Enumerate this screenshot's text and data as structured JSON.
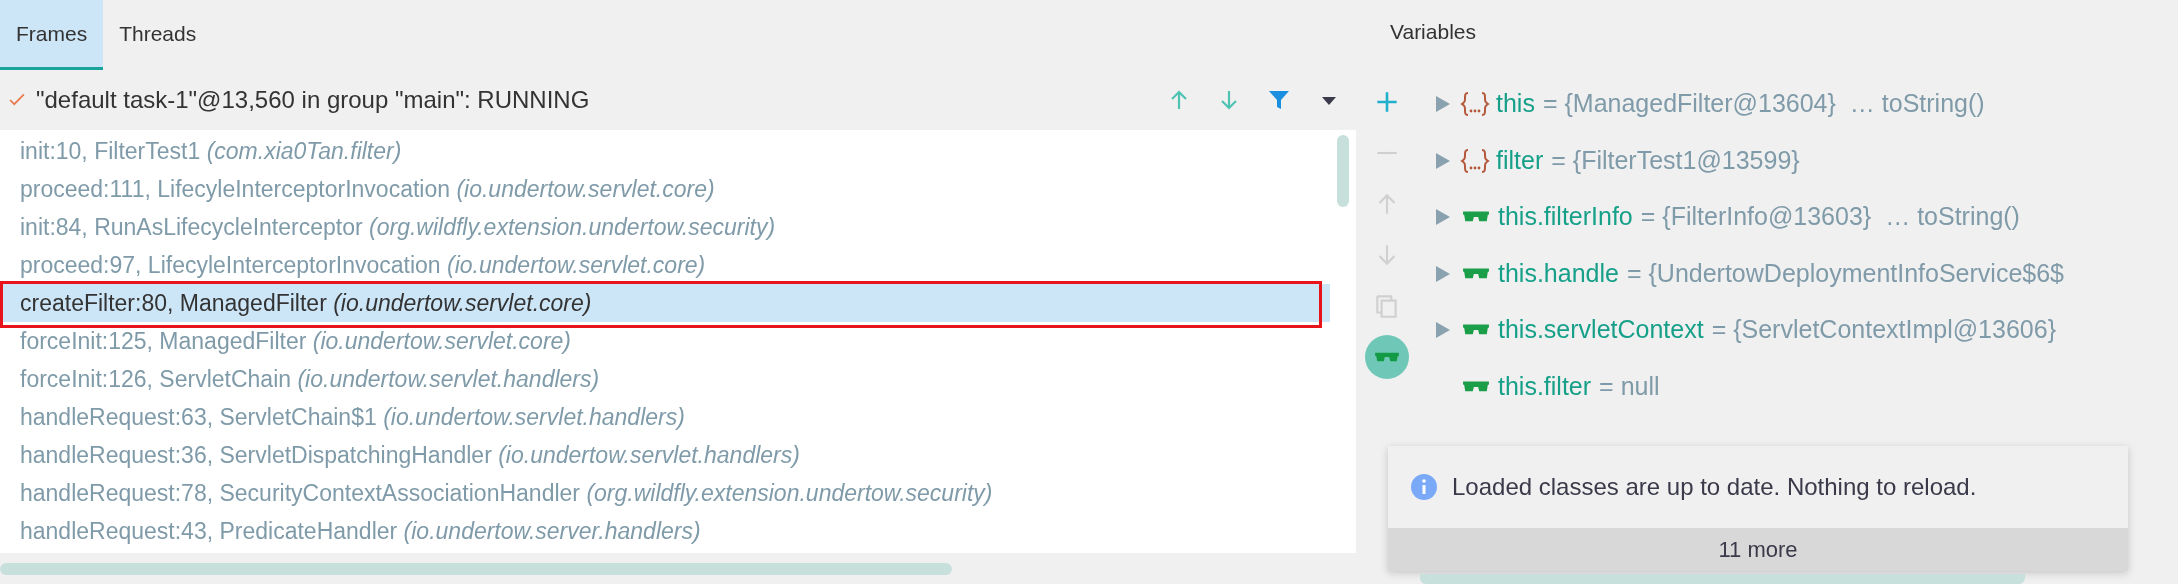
{
  "tabs": [
    {
      "label": "Frames",
      "selected": true
    },
    {
      "label": "Threads",
      "selected": false
    }
  ],
  "thread": {
    "text": "\"default task-1\"@13,560 in group \"main\": RUNNING"
  },
  "frames": [
    {
      "method": "init:10, FilterTest1",
      "package": "(com.xia0Tan.filter)",
      "selected": false,
      "boxed": false
    },
    {
      "method": "proceed:111, LifecyleInterceptorInvocation",
      "package": "(io.undertow.servlet.core)",
      "selected": false,
      "boxed": false
    },
    {
      "method": "init:84, RunAsLifecycleInterceptor",
      "package": "(org.wildfly.extension.undertow.security)",
      "selected": false,
      "boxed": false
    },
    {
      "method": "proceed:97, LifecyleInterceptorInvocation",
      "package": "(io.undertow.servlet.core)",
      "selected": false,
      "boxed": false
    },
    {
      "method": "createFilter:80, ManagedFilter",
      "package": "(io.undertow.servlet.core)",
      "selected": true,
      "boxed": true
    },
    {
      "method": "forceInit:125, ManagedFilter",
      "package": "(io.undertow.servlet.core)",
      "selected": false,
      "boxed": false
    },
    {
      "method": "forceInit:126, ServletChain",
      "package": "(io.undertow.servlet.handlers)",
      "selected": false,
      "boxed": false
    },
    {
      "method": "handleRequest:63, ServletChain$1",
      "package": "(io.undertow.servlet.handlers)",
      "selected": false,
      "boxed": false
    },
    {
      "method": "handleRequest:36, ServletDispatchingHandler",
      "package": "(io.undertow.servlet.handlers)",
      "selected": false,
      "boxed": false
    },
    {
      "method": "handleRequest:78, SecurityContextAssociationHandler",
      "package": "(org.wildfly.extension.undertow.security)",
      "selected": false,
      "boxed": false
    },
    {
      "method": "handleRequest:43, PredicateHandler",
      "package": "(io.undertow.server.handlers)",
      "selected": false,
      "boxed": false
    }
  ],
  "variables_title": "Variables",
  "variable_tools": [
    {
      "kind": "add",
      "disabled": false,
      "on": false
    },
    {
      "kind": "remove",
      "disabled": true,
      "on": false
    },
    {
      "kind": "up",
      "disabled": true,
      "on": false
    },
    {
      "kind": "down",
      "disabled": true,
      "on": false
    },
    {
      "kind": "copy",
      "disabled": true,
      "on": false
    },
    {
      "kind": "watches",
      "disabled": false,
      "on": true
    }
  ],
  "variables": [
    {
      "kind": "object",
      "name": "this",
      "value": "= {ManagedFilter@13604}",
      "extra": "… toString()",
      "expandable": true
    },
    {
      "kind": "object",
      "name": "filter",
      "value": "= {FilterTest1@13599}",
      "expandable": true
    },
    {
      "kind": "watch",
      "name": "this.filterInfo",
      "value": "= {FilterInfo@13603}",
      "extra": "… toString()",
      "expandable": true
    },
    {
      "kind": "watch",
      "name": "this.handle",
      "value": "= {UndertowDeploymentInfoService$6$",
      "expandable": true
    },
    {
      "kind": "watch",
      "name": "this.servletContext",
      "value": "= {ServletContextImpl@13606}",
      "expandable": true
    },
    {
      "kind": "watch",
      "name": "this.filter",
      "value": "= null",
      "expandable": false
    }
  ],
  "notification": {
    "text": "Loaded classes are up to date. Nothing to reload.",
    "more": "11 more"
  }
}
